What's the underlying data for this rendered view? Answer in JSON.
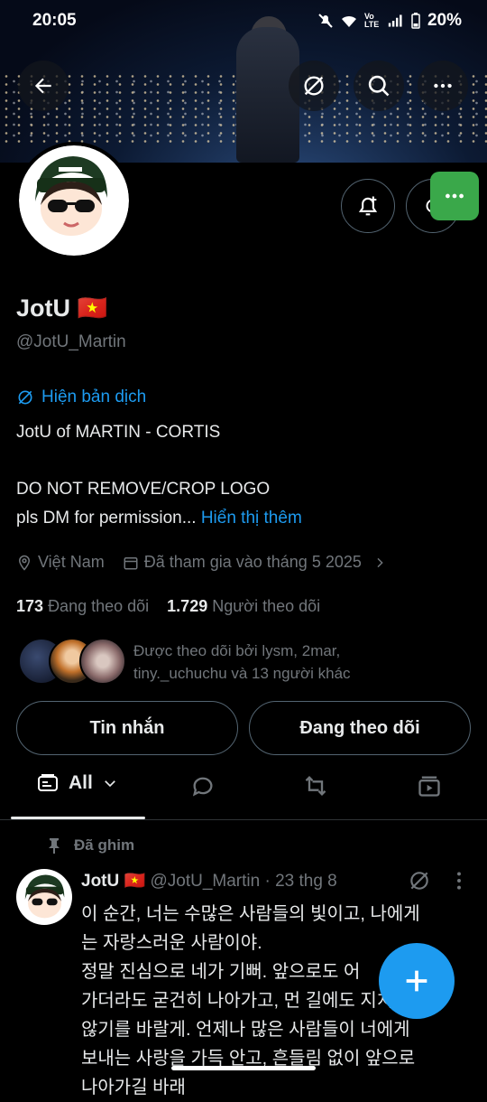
{
  "status": {
    "time": "20:05",
    "battery": "20%",
    "network": "Vo LTE"
  },
  "banner": {
    "icon_buttons": [
      "back-icon",
      "translate-off-icon",
      "search-icon",
      "more-icon"
    ]
  },
  "profile": {
    "name": "JotU",
    "flag": "🇻🇳",
    "handle": "@JotU_Martin",
    "translate_label": "Hiện bản dịch",
    "bio_line1": "JotU of MARTIN - CORTIS",
    "bio_line2": "DO NOT REMOVE/CROP LOGO",
    "bio_line3": "pls DM for permission...",
    "show_more": "Hiển thị thêm",
    "location": "Việt Nam",
    "joined": "Đã tham gia vào tháng 5 2025",
    "following_count": "173",
    "following_label": "Đang theo dõi",
    "followers_count": "1.729",
    "followers_label": "Người theo dõi",
    "followed_by": "Được theo dõi bởi lysm, 2mar, tiny._uchuchu và 13 người khác",
    "message_button": "Tin nhắn",
    "following_button": "Đang theo dõi"
  },
  "tabs": {
    "all_label": "All",
    "others": [
      "reply-icon",
      "repost-icon",
      "media-icon"
    ]
  },
  "post": {
    "pinned_label": "Đã ghim",
    "author": "JotU",
    "flag": "🇻🇳",
    "handle": "@JotU_Martin",
    "date": "· 23 thg 8",
    "line1": "이 순간, 너는 수많은 사람들의 빛이고, 나에게",
    "line2": "는 자랑스러운 사람이야.",
    "line3": "정말 진심으로 네가 기뻐. 앞으로도 어",
    "line4": "가더라도 굳건히 나아가고, 먼 길에도 지치",
    "line5": "않기를 바랄게.  언제나 많은 사람들이 너에게",
    "line6": "보내는 사랑을 가득 안고, 흔들림 없이 앞으로",
    "line7": "나아가길 바래"
  },
  "colors": {
    "accent": "#1d9bf0",
    "muted": "#71767b",
    "text": "#e7e9ea",
    "green": "#3aa84a"
  }
}
